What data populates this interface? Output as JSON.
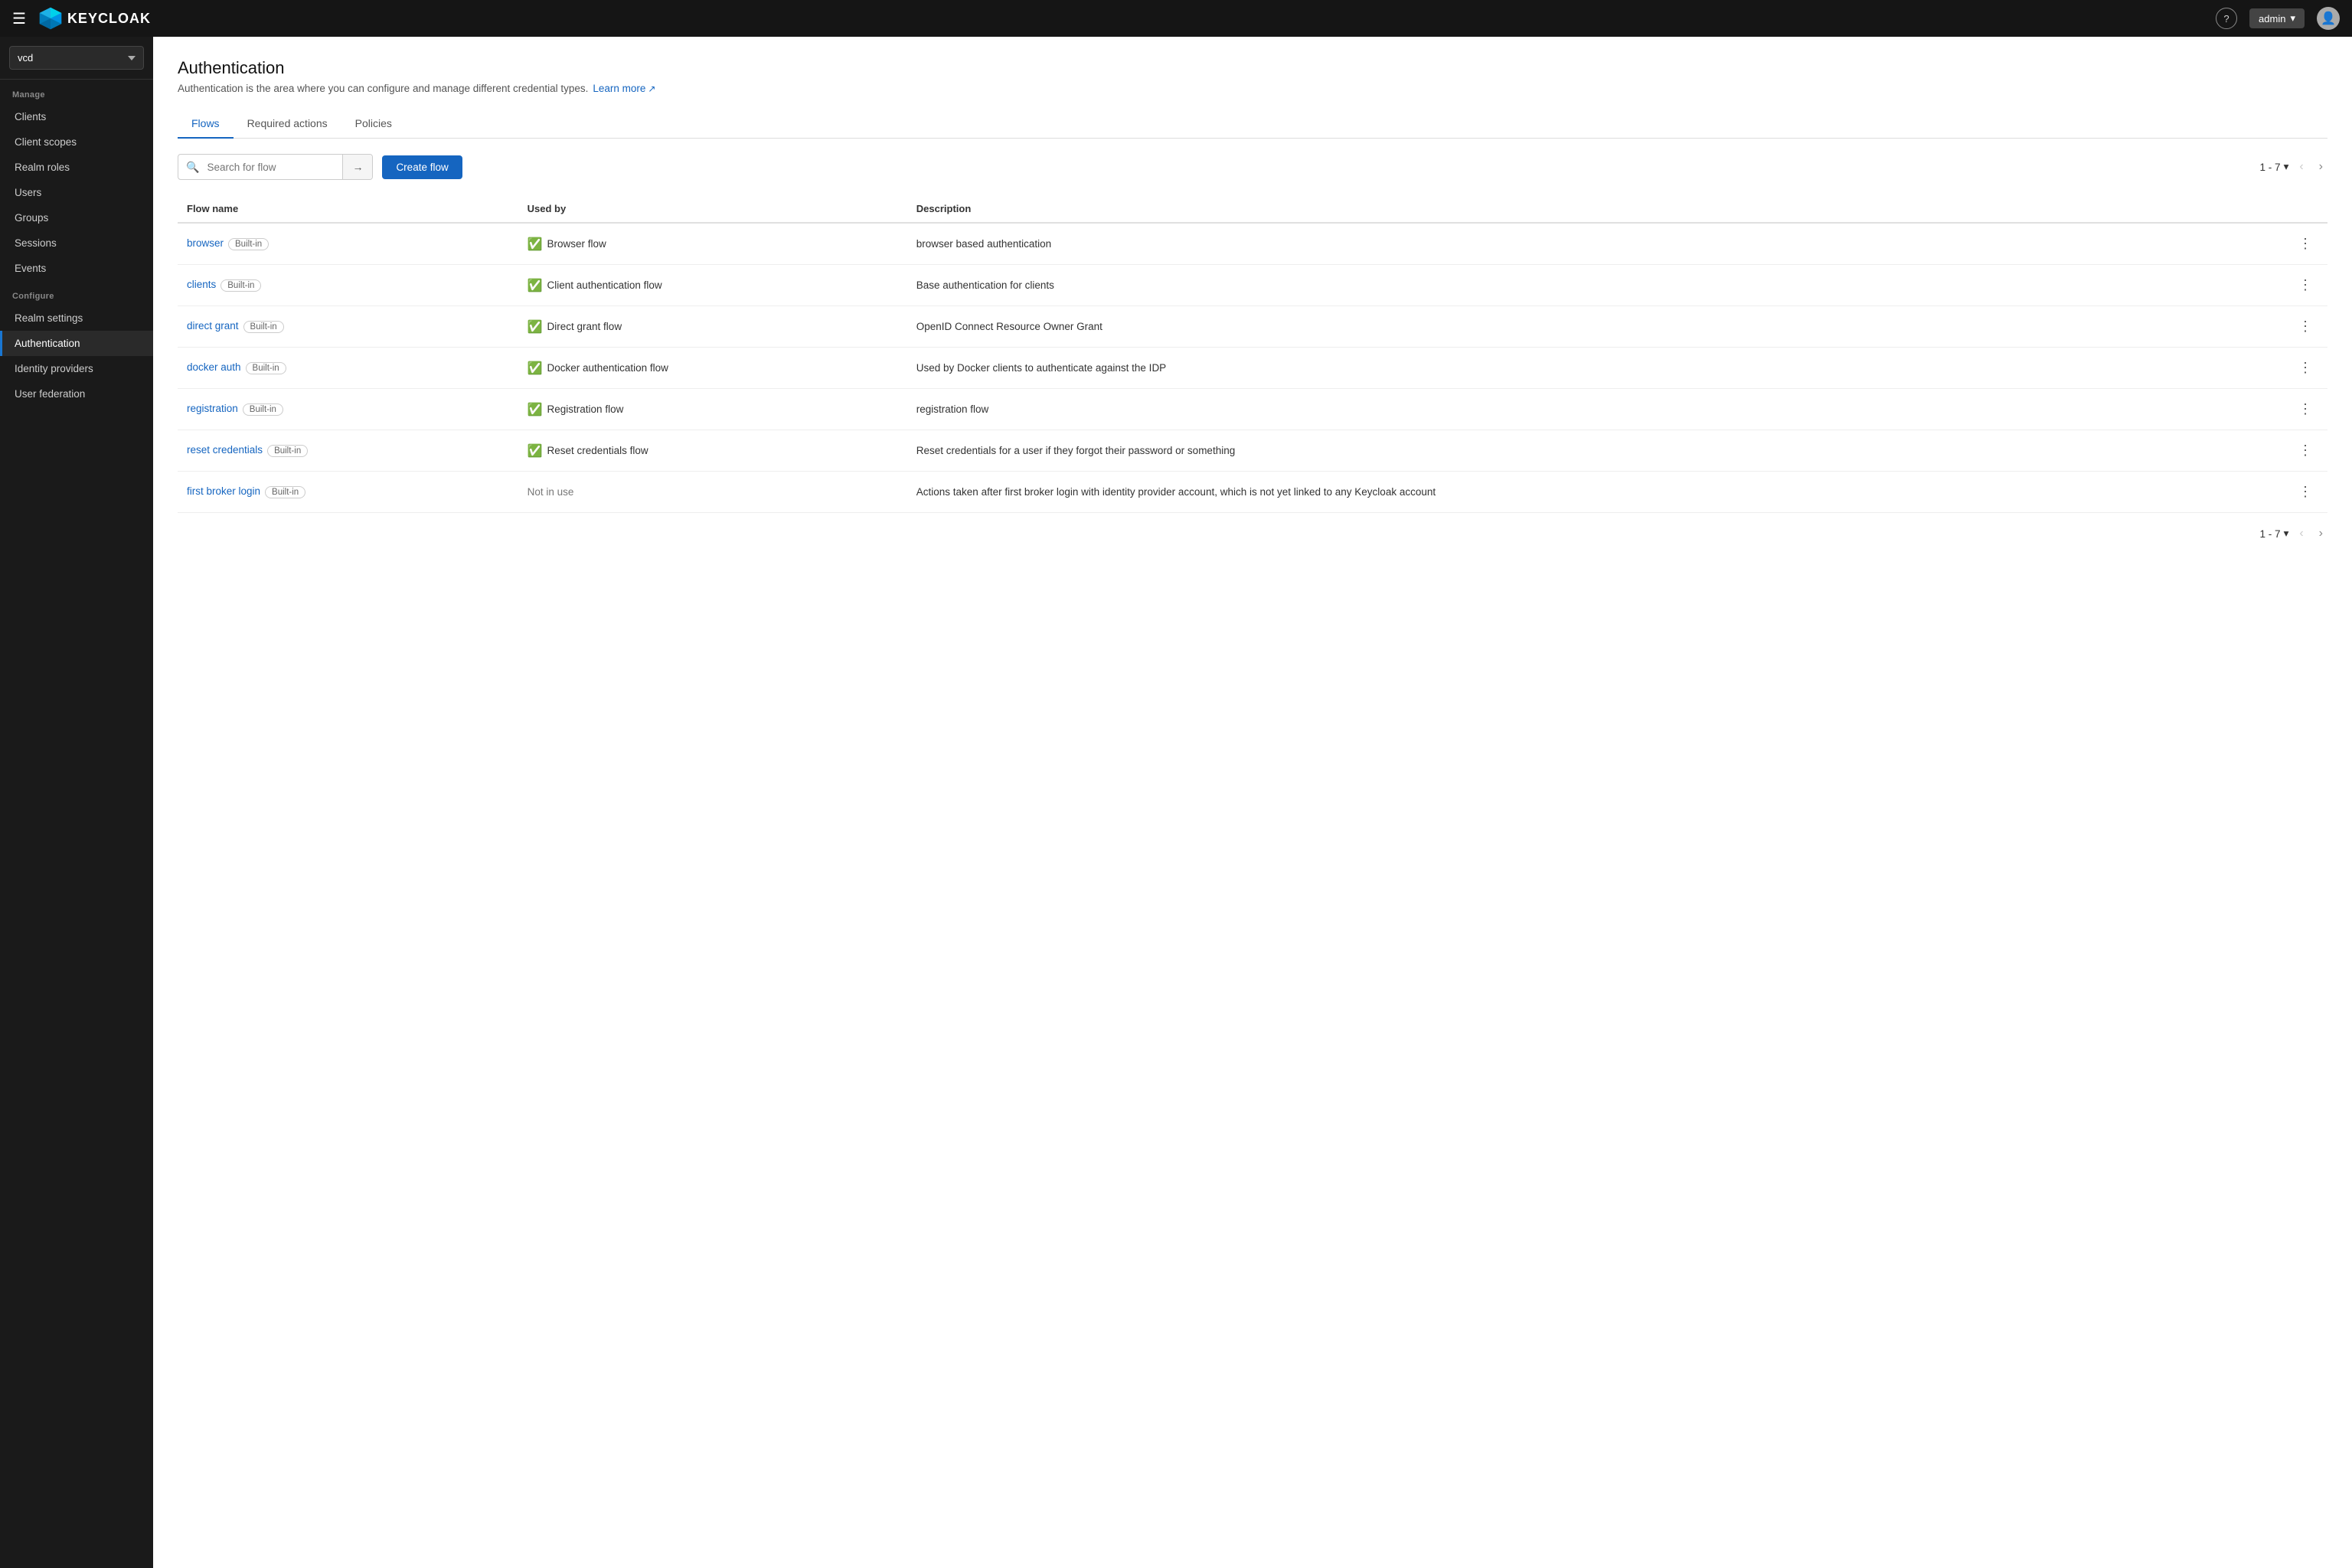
{
  "topbar": {
    "logo_text": "KEYCLOAK",
    "help_label": "?",
    "user_button_label": "admin",
    "chevron": "▾"
  },
  "sidebar": {
    "realm_value": "vcd",
    "realm_options": [
      "vcd"
    ],
    "section_manage": "Manage",
    "items_manage": [
      {
        "label": "Clients",
        "id": "clients"
      },
      {
        "label": "Client scopes",
        "id": "client-scopes"
      },
      {
        "label": "Realm roles",
        "id": "realm-roles"
      },
      {
        "label": "Users",
        "id": "users"
      },
      {
        "label": "Groups",
        "id": "groups"
      },
      {
        "label": "Sessions",
        "id": "sessions"
      },
      {
        "label": "Events",
        "id": "events"
      }
    ],
    "section_configure": "Configure",
    "items_configure": [
      {
        "label": "Realm settings",
        "id": "realm-settings"
      },
      {
        "label": "Authentication",
        "id": "authentication",
        "active": true
      },
      {
        "label": "Identity providers",
        "id": "identity-providers"
      },
      {
        "label": "User federation",
        "id": "user-federation"
      }
    ]
  },
  "page": {
    "title": "Authentication",
    "description": "Authentication is the area where you can configure and manage different credential types.",
    "learn_more_label": "Learn more",
    "external_icon": "↗"
  },
  "tabs": [
    {
      "label": "Flows",
      "id": "flows",
      "active": true
    },
    {
      "label": "Required actions",
      "id": "required-actions"
    },
    {
      "label": "Policies",
      "id": "policies"
    }
  ],
  "toolbar": {
    "search_placeholder": "Search for flow",
    "search_arrow": "→",
    "create_flow_label": "Create flow",
    "pagination_label": "1 - 7",
    "pagination_chevron": "▾",
    "prev_nav": "‹",
    "next_nav": "›"
  },
  "table": {
    "columns": [
      {
        "label": "Flow name",
        "id": "flow-name"
      },
      {
        "label": "Used by",
        "id": "used-by"
      },
      {
        "label": "Description",
        "id": "description"
      }
    ],
    "rows": [
      {
        "name": "browser",
        "badge": "Built-in",
        "used_by": "Browser flow",
        "used_by_active": true,
        "description": "browser based authentication"
      },
      {
        "name": "clients",
        "badge": "Built-in",
        "used_by": "Client authentication flow",
        "used_by_active": true,
        "description": "Base authentication for clients"
      },
      {
        "name": "direct grant",
        "badge": "Built-in",
        "used_by": "Direct grant flow",
        "used_by_active": true,
        "description": "OpenID Connect Resource Owner Grant"
      },
      {
        "name": "docker auth",
        "badge": "Built-in",
        "used_by": "Docker authentication flow",
        "used_by_active": true,
        "description": "Used by Docker clients to authenticate against the IDP"
      },
      {
        "name": "registration",
        "badge": "Built-in",
        "used_by": "Registration flow",
        "used_by_active": true,
        "description": "registration flow"
      },
      {
        "name": "reset credentials",
        "badge": "Built-in",
        "used_by": "Reset credentials flow",
        "used_by_active": true,
        "description": "Reset credentials for a user if they forgot their password or something"
      },
      {
        "name": "first broker login",
        "badge": "Built-in",
        "used_by": "Not in use",
        "used_by_active": false,
        "description": "Actions taken after first broker login with identity provider account, which is not yet linked to any Keycloak account"
      }
    ]
  },
  "bottom_pagination": {
    "label": "1 - 7",
    "chevron": "▾",
    "prev": "‹",
    "next": "›"
  }
}
